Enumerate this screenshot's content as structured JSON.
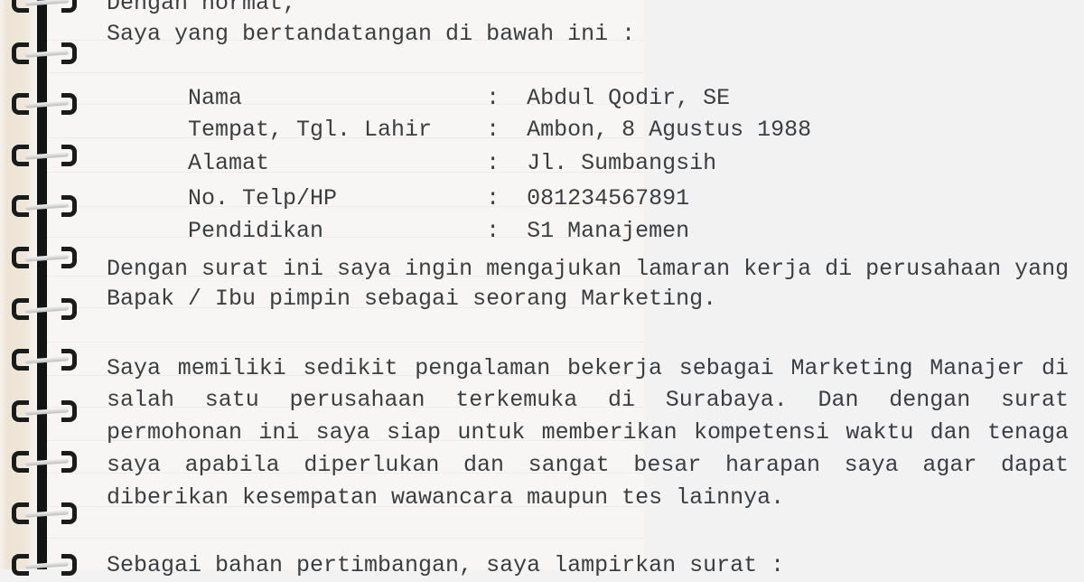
{
  "letter": {
    "greeting": "Dengan hormat,",
    "intro": "Saya yang bertandatangan di bawah ini :",
    "fields": [
      {
        "label": "Nama",
        "separator": ":",
        "value": "Abdul Qodir, SE"
      },
      {
        "label": "Tempat, Tgl. Lahir",
        "separator": ":",
        "value": "Ambon, 8 Agustus 1988"
      },
      {
        "label": "Alamat",
        "separator": ":",
        "value": "Jl. Sumbangsih"
      },
      {
        "label": "No. Telp/HP",
        "separator": ":",
        "value": "081234567891"
      },
      {
        "label": "Pendidikan",
        "separator": ":",
        "value": "S1 Manajemen"
      }
    ],
    "paragraph1": [
      "Dengan surat ini saya ingin mengajukan lamaran kerja di perusahaan yang",
      "Bapak / Ibu pimpin sebagai seorang Marketing."
    ],
    "paragraph2": [
      "Saya memiliki sedikit pengalaman bekerja sebagai Marketing Manajer di",
      "salah satu perusahaan terkemuka di Surabaya. Dan dengan surat",
      "permohonan ini saya siap untuk memberikan kompetensi waktu dan tenaga",
      "saya apabila diperlukan dan sangat besar harapan saya agar dapat",
      "diberikan kesempatan wawancara maupun tes lainnya."
    ],
    "paragraph3": [
      "Sebagai bahan pertimbangan, saya lampirkan surat :"
    ]
  },
  "notebook": {
    "binding_icon": "spiral-binding-icon",
    "colors": {
      "page_background": "#f3f2f3",
      "text": "#3b3e41",
      "spine": "#111413"
    }
  }
}
